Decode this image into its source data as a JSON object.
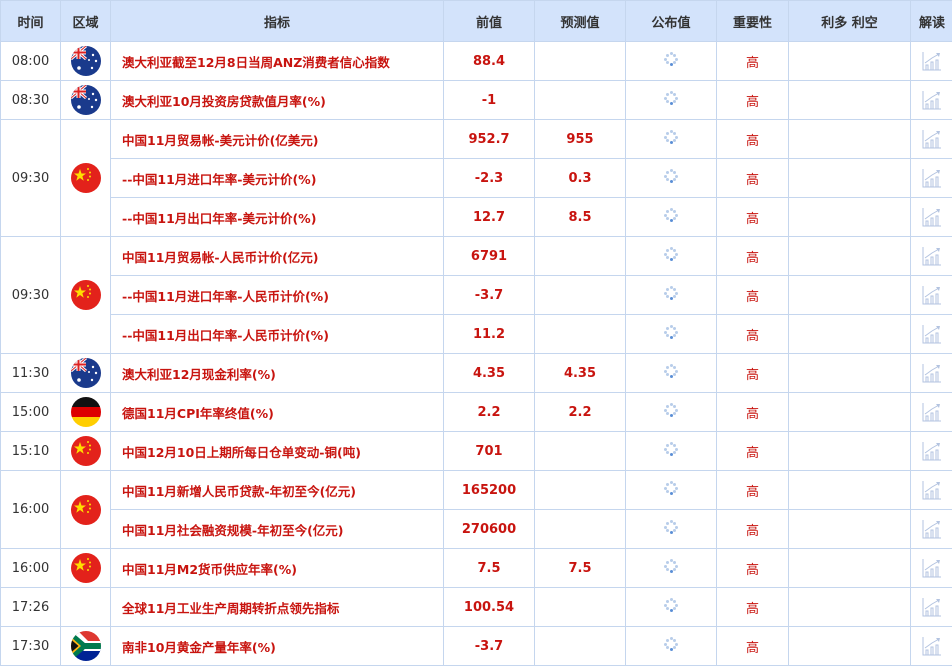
{
  "headers": [
    "时间",
    "区域",
    "指标",
    "前值",
    "预测值",
    "公布值",
    "重要性",
    "利多 利空",
    "解读"
  ],
  "groups": [
    {
      "time": "08:00",
      "flag": "australia-flag",
      "rows": [
        {
          "event": "澳大利亚截至12月8日当周ANZ消费者信心指数",
          "prev": "88.4",
          "forecast": "",
          "importance": "高"
        }
      ]
    },
    {
      "time": "08:30",
      "flag": "australia-flag",
      "rows": [
        {
          "event": "澳大利亚10月投资房贷款值月率(%)",
          "prev": "-1",
          "forecast": "",
          "importance": "高"
        }
      ]
    },
    {
      "time": "09:30",
      "flag": "china-flag",
      "rows": [
        {
          "event": "中国11月贸易帐-美元计价(亿美元)",
          "prev": "952.7",
          "forecast": "955",
          "importance": "高"
        },
        {
          "event": "--中国11月进口年率-美元计价(%)",
          "prev": "-2.3",
          "forecast": "0.3",
          "importance": "高"
        },
        {
          "event": "--中国11月出口年率-美元计价(%)",
          "prev": "12.7",
          "forecast": "8.5",
          "importance": "高"
        }
      ]
    },
    {
      "time": "09:30",
      "flag": "china-flag",
      "rows": [
        {
          "event": "中国11月贸易帐-人民币计价(亿元)",
          "prev": "6791",
          "forecast": "",
          "importance": "高"
        },
        {
          "event": "--中国11月进口年率-人民币计价(%)",
          "prev": "-3.7",
          "forecast": "",
          "importance": "高"
        },
        {
          "event": "--中国11月出口年率-人民币计价(%)",
          "prev": "11.2",
          "forecast": "",
          "importance": "高"
        }
      ]
    },
    {
      "time": "11:30",
      "flag": "australia-flag",
      "rows": [
        {
          "event": "澳大利亚12月现金利率(%)",
          "prev": "4.35",
          "forecast": "4.35",
          "importance": "高"
        }
      ]
    },
    {
      "time": "15:00",
      "flag": "germany-flag",
      "rows": [
        {
          "event": "德国11月CPI年率终值(%)",
          "prev": "2.2",
          "forecast": "2.2",
          "importance": "高"
        }
      ]
    },
    {
      "time": "15:10",
      "flag": "china-flag",
      "rows": [
        {
          "event": "中国12月10日上期所每日仓单变动-铜(吨)",
          "prev": "701",
          "forecast": "",
          "importance": "高"
        }
      ]
    },
    {
      "time": "16:00",
      "flag": "china-flag",
      "rows": [
        {
          "event": "中国11月新增人民币贷款-年初至今(亿元)",
          "prev": "165200",
          "forecast": "",
          "importance": "高"
        },
        {
          "event": "中国11月社会融资规模-年初至今(亿元)",
          "prev": "270600",
          "forecast": "",
          "importance": "高"
        }
      ]
    },
    {
      "time": "16:00",
      "flag": "china-flag",
      "rows": [
        {
          "event": "中国11月M2货币供应年率(%)",
          "prev": "7.5",
          "forecast": "7.5",
          "importance": "高"
        }
      ]
    },
    {
      "time": "17:26",
      "flag": "",
      "rows": [
        {
          "event": "全球11月工业生产周期转折点领先指标",
          "prev": "100.54",
          "forecast": "",
          "importance": "高"
        }
      ]
    },
    {
      "time": "17:30",
      "flag": "south-africa-flag",
      "rows": [
        {
          "event": "南非10月黄金产量年率(%)",
          "prev": "-3.7",
          "forecast": "",
          "importance": "高"
        }
      ]
    }
  ]
}
